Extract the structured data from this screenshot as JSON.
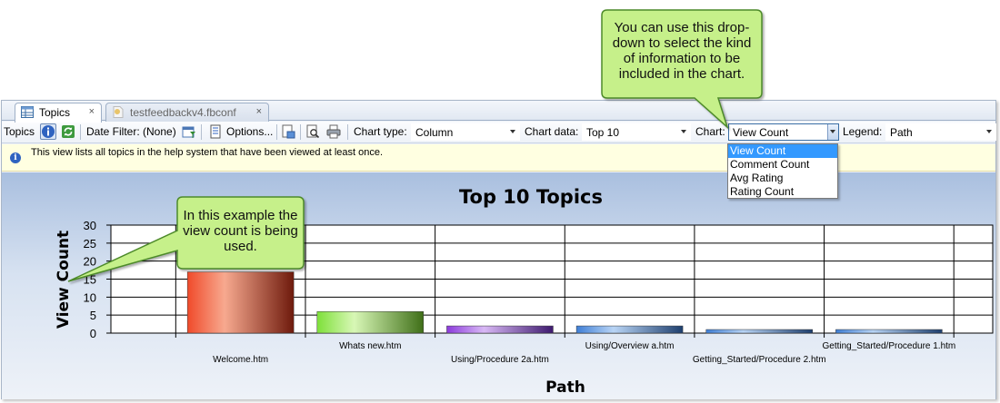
{
  "tabs": [
    {
      "label": "Topics",
      "icon": "grid-icon",
      "close": "×"
    },
    {
      "label": "testfeedbackv4.fbconf",
      "icon": "document-icon",
      "close": "×"
    }
  ],
  "toolbar": {
    "topics_label": "Topics",
    "date_filter_label": "Date Filter: (None)",
    "options_label": "Options...",
    "chart_type_label": "Chart type:",
    "chart_type_value": "Column",
    "chart_data_label": "Chart data:",
    "chart_data_value": "Top 10",
    "chart_label": "Chart:",
    "chart_value": "View Count",
    "legend_label": "Legend:",
    "legend_value": "Path"
  },
  "info": {
    "icon": "i",
    "text": "This view lists all topics in the help system that have been viewed at least once."
  },
  "chart_dropdown": {
    "options": [
      "View Count",
      "Comment Count",
      "Avg Rating",
      "Rating Count"
    ],
    "selected": "View Count"
  },
  "chart_data": {
    "type": "bar",
    "title": "Top 10 Topics",
    "xlabel": "Path",
    "ylabel": "View Count",
    "ylim": [
      0,
      30
    ],
    "yticks": [
      "0",
      "5",
      "10",
      "15",
      "20",
      "25",
      "30"
    ],
    "categories": [
      "Welcome.htm",
      "Whats new.htm",
      "Using/Procedure 2a.htm",
      "Using/Overview a.htm",
      "Getting_Started/Procedure 2.htm",
      "Getting_Started/Procedure 1.htm"
    ],
    "values": [
      17,
      6,
      2,
      2,
      1,
      1
    ],
    "bar_colors": [
      [
        "#f04a2a",
        "#f7a98f",
        "#6e1a0c"
      ],
      [
        "#7ee03a",
        "#d8f7b6",
        "#3f6f18"
      ],
      [
        "#8c3bdc",
        "#d8b8f5",
        "#3e1a6e"
      ],
      [
        "#3f7fd6",
        "#b8d4f5",
        "#1e3f6e"
      ],
      [
        "#3f7fd6",
        "#b8d4f5",
        "#1e3f6e"
      ],
      [
        "#3f7fd6",
        "#b8d4f5",
        "#1e3f6e"
      ]
    ],
    "grid": true
  },
  "callouts": {
    "top": "You can use this drop-down to select the kind of information to be included in the chart.",
    "left": "In this example the view count is being used."
  },
  "colors": {
    "callout_fill": "#c6f08a",
    "callout_border": "#4d8a2a",
    "dropdown_selected": "#3399ff"
  }
}
